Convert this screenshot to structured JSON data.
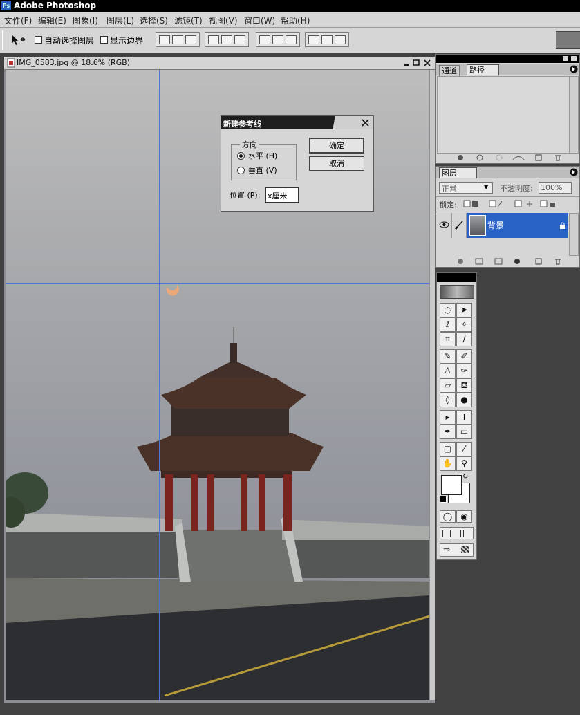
{
  "app": {
    "title": "Adobe Photoshop",
    "logo": "Ps"
  },
  "menu": [
    "文件(F)",
    "编辑(E)",
    "图象(I)",
    "图层(L)",
    "选择(S)",
    "滤镜(T)",
    "视图(V)",
    "窗口(W)",
    "帮助(H)"
  ],
  "options": {
    "auto_select_layer": "自动选择图层",
    "show_bounds": "显示边界"
  },
  "document": {
    "title": "IMG_0583.jpg @ 18.6% (RGB)"
  },
  "dialog": {
    "title": "新建参考线",
    "orientation_group": "方向",
    "horizontal": "水平 (H)",
    "vertical": "垂直 (V)",
    "position_label": "位置 (P):",
    "position_value": "x厘米",
    "ok": "确定",
    "cancel": "取消",
    "selected": "horizontal"
  },
  "paths_panel": {
    "tabs": [
      "通道",
      "路径"
    ],
    "active": "路径"
  },
  "layers_panel": {
    "tab": "图层",
    "blend_mode": "正常",
    "opacity_label": "不透明度:",
    "opacity_value": "100%",
    "lock_label": "锁定:",
    "layers": [
      {
        "name": "背景",
        "visible": true,
        "locked": true
      }
    ]
  },
  "colors": {
    "accent": "#2a63c6",
    "guide": "#4f73d8"
  }
}
